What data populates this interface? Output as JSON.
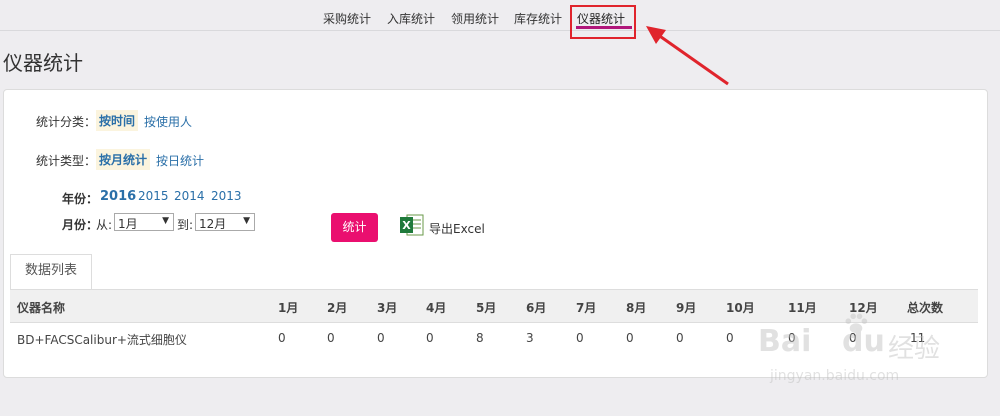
{
  "topnav": {
    "items": [
      {
        "label": "采购统计"
      },
      {
        "label": "入库统计"
      },
      {
        "label": "领用统计"
      },
      {
        "label": "库存统计"
      },
      {
        "label": "仪器统计"
      }
    ],
    "accent_color": "#b0167a",
    "highlight_color": "#e0242c"
  },
  "page": {
    "title": "仪器统计"
  },
  "filters": {
    "category": {
      "label": "统计分类：",
      "options": [
        "按时间",
        "按使用人"
      ],
      "selected": "按时间"
    },
    "type": {
      "label": "统计类型：",
      "options": [
        "按月统计",
        "按日统计"
      ],
      "selected": "按月统计"
    },
    "year": {
      "label": "年份：",
      "options": [
        "2016",
        "2015",
        "2014",
        "2013"
      ],
      "selected": "2016"
    },
    "month": {
      "label": "月份：",
      "from_label": "从:",
      "from_value": "1月",
      "to_label": "到:",
      "to_value": "12月"
    }
  },
  "actions": {
    "stat_button": "统计",
    "export_label": "导出Excel",
    "stat_color": "#ea0f6f"
  },
  "tab": {
    "label": "数据列表"
  },
  "table": {
    "headers": [
      "仪器名称",
      "1月",
      "2月",
      "3月",
      "4月",
      "5月",
      "6月",
      "7月",
      "8月",
      "9月",
      "10月",
      "11月",
      "12月",
      "总次数"
    ],
    "rows": [
      [
        "BD+FACSCalibur+流式细胞仪",
        "0",
        "0",
        "0",
        "0",
        "8",
        "3",
        "0",
        "0",
        "0",
        "0",
        "0",
        "0",
        "11"
      ]
    ]
  },
  "watermark": {
    "brand": "Bai",
    "brand2": "du",
    "cn": "经验",
    "url": "jingyan.baidu.com"
  }
}
